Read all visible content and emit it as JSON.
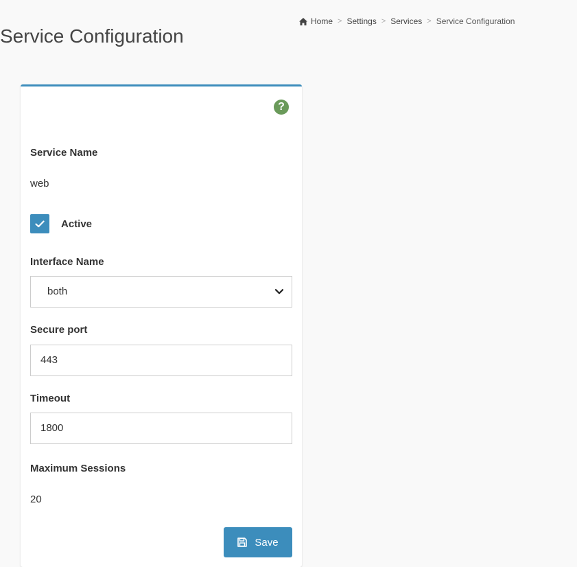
{
  "page": {
    "title": "Service Configuration"
  },
  "breadcrumb": {
    "items": [
      "Home",
      "Settings",
      "Services",
      "Service Configuration"
    ],
    "separator": ">"
  },
  "form": {
    "help_icon": "?",
    "service_name_label": "Service Name",
    "service_name_value": "web",
    "active_label": "Active",
    "active_checked": true,
    "interface_label": "Interface Name",
    "interface_value": "both",
    "secure_port_label": "Secure port",
    "secure_port_value": "443",
    "timeout_label": "Timeout",
    "timeout_value": "1800",
    "max_sessions_label": "Maximum Sessions",
    "max_sessions_value": "20",
    "save_label": "Save"
  },
  "colors": {
    "accent": "#3c8dbc",
    "help": "#6a9a5a",
    "background": "#f9f9f9"
  },
  "icons": [
    "home-icon",
    "help-icon",
    "check-icon",
    "chevron-down-icon",
    "save-icon"
  ]
}
